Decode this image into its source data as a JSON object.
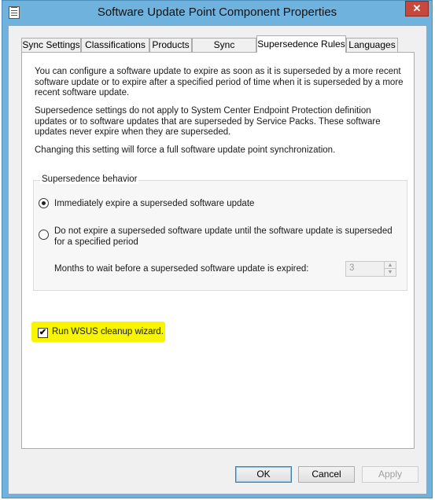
{
  "window": {
    "title": "Software Update Point Component Properties",
    "close_symbol": "✕"
  },
  "tabs": [
    {
      "label": "Sync Settings",
      "active": false
    },
    {
      "label": "Classifications",
      "active": false
    },
    {
      "label": "Products",
      "active": false
    },
    {
      "label": "Sync Schedule",
      "active": false
    },
    {
      "label": "Supersedence Rules",
      "active": true
    },
    {
      "label": "Languages",
      "active": false
    }
  ],
  "panel": {
    "intro": "You can configure a software update to expire as soon as it is superseded by a more recent software update or to expire after a specified period of time when it is superseded by a more recent software update.",
    "note": "Supersedence settings do not apply to System Center Endpoint Protection definition updates or to software updates that are superseded by Service Packs. These software updates never expire when they are superseded.",
    "warning": "Changing this setting will force a full software update point synchronization."
  },
  "supersedence": {
    "group_label": "Supersedence behavior",
    "option_immediate": "Immediately expire a superseded software update",
    "option_delay": "Do not expire a superseded software update until the software update is superseded for a specified period",
    "selected": "immediate",
    "months_label": "Months to wait before a superseded software update is expired:",
    "months_value": "3"
  },
  "cleanup": {
    "label": "Run WSUS cleanup wizard.",
    "checked": true,
    "check_symbol": "✔",
    "highlight_color": "#f7f500"
  },
  "buttons": {
    "ok": "OK",
    "cancel": "Cancel",
    "apply": "Apply"
  }
}
